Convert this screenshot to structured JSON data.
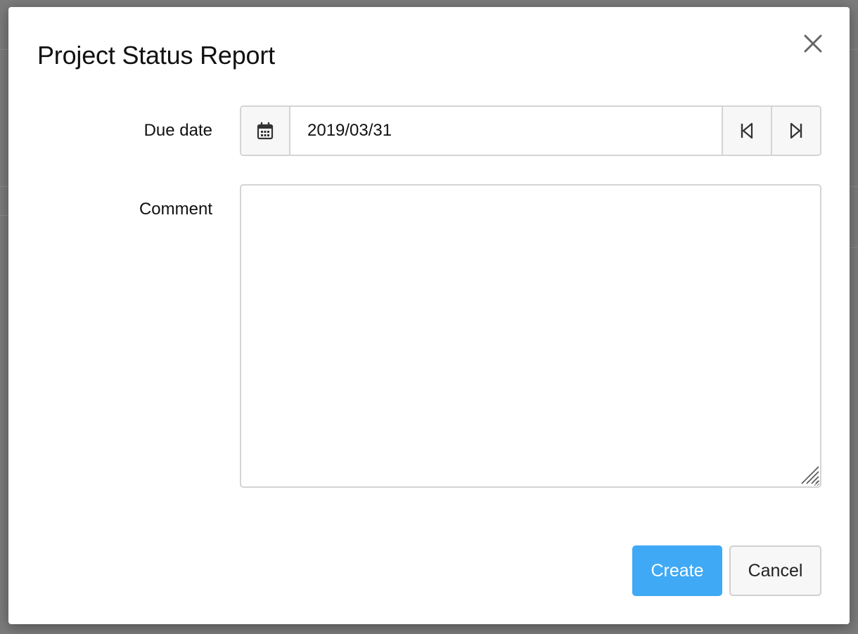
{
  "dialog": {
    "title": "Project Status Report",
    "close_icon": "close-icon"
  },
  "form": {
    "due_date": {
      "label": "Due date",
      "value": "2019/03/31",
      "calendar_icon": "calendar-icon",
      "prev_icon": "skip-previous-icon",
      "next_icon": "skip-next-icon"
    },
    "comment": {
      "label": "Comment",
      "value": ""
    }
  },
  "actions": {
    "create_label": "Create",
    "cancel_label": "Cancel"
  },
  "colors": {
    "primary": "#3fa9f5",
    "overlay": "#7b7b7b",
    "border": "#d4d4d4"
  }
}
